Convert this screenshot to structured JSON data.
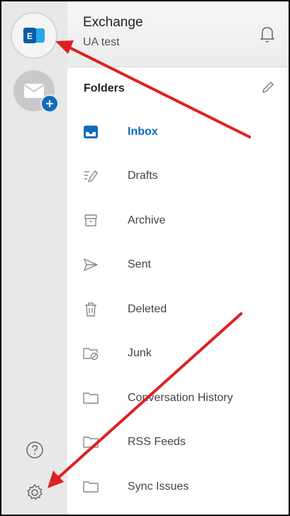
{
  "account": {
    "name": "Exchange",
    "email": "UA test",
    "avatar_letter": "E"
  },
  "folders": {
    "title": "Folders",
    "items": [
      {
        "label": "Inbox",
        "icon": "inbox-icon",
        "active": true
      },
      {
        "label": "Drafts",
        "icon": "drafts-icon"
      },
      {
        "label": "Archive",
        "icon": "archive-icon"
      },
      {
        "label": "Sent",
        "icon": "sent-icon"
      },
      {
        "label": "Deleted",
        "icon": "trash-icon"
      },
      {
        "label": "Junk",
        "icon": "junk-folder-icon"
      },
      {
        "label": "Conversation History",
        "icon": "folder-icon"
      },
      {
        "label": "RSS Feeds",
        "icon": "folder-icon"
      },
      {
        "label": "Sync Issues",
        "icon": "folder-icon"
      }
    ]
  },
  "rail": {
    "help_icon": "help-icon",
    "settings_icon": "settings-gear-icon"
  },
  "colors": {
    "accent": "#0f6cbd",
    "rail_bg": "#e8e8e8",
    "annotation_arrow": "#e02020"
  }
}
